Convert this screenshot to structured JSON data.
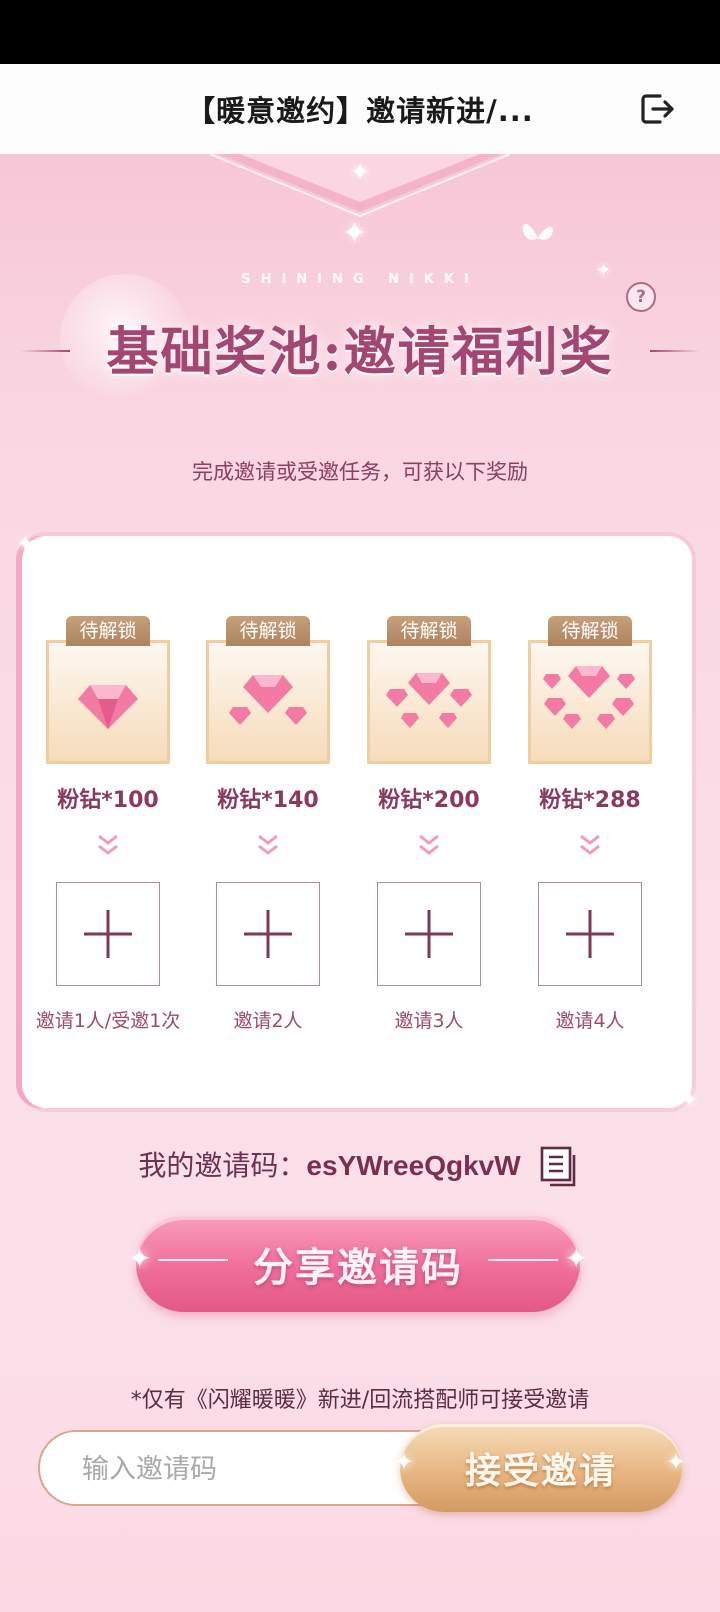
{
  "nav": {
    "title": "【暖意邀约】邀请新进/..."
  },
  "banner": {
    "brand_text": "SHINING NIKKI",
    "help_symbol": "?",
    "pool_title": "基础奖池:邀请福利奖"
  },
  "subtitle": "完成邀请或受邀任务，可获以下奖励",
  "rewards": [
    {
      "status": "待解锁",
      "label": "粉钻*100",
      "task": "邀请1人/受邀1次",
      "icon": "single-pink-diamond-icon"
    },
    {
      "status": "待解锁",
      "label": "粉钻*140",
      "task": "邀请2人",
      "icon": "three-pink-diamonds-icon"
    },
    {
      "status": "待解锁",
      "label": "粉钻*200",
      "task": "邀请3人",
      "icon": "five-pink-diamonds-icon"
    },
    {
      "status": "待解锁",
      "label": "粉钻*288",
      "task": "邀请4人",
      "icon": "many-pink-diamonds-icon"
    }
  ],
  "invite": {
    "label": "我的邀请码：",
    "code": "esYWreeQgkvW"
  },
  "share_button": "分享邀请码",
  "notice": "*仅有《闪耀暖暖》新进/回流搭配师可接受邀请",
  "code_input": {
    "placeholder": "输入邀请码",
    "value": ""
  },
  "accept_button": "接受邀请",
  "colors": {
    "accent_pink": "#f06e9a",
    "title_plum": "#a34672",
    "gold_button": "#e6b27e",
    "background": "#fbdde7"
  }
}
